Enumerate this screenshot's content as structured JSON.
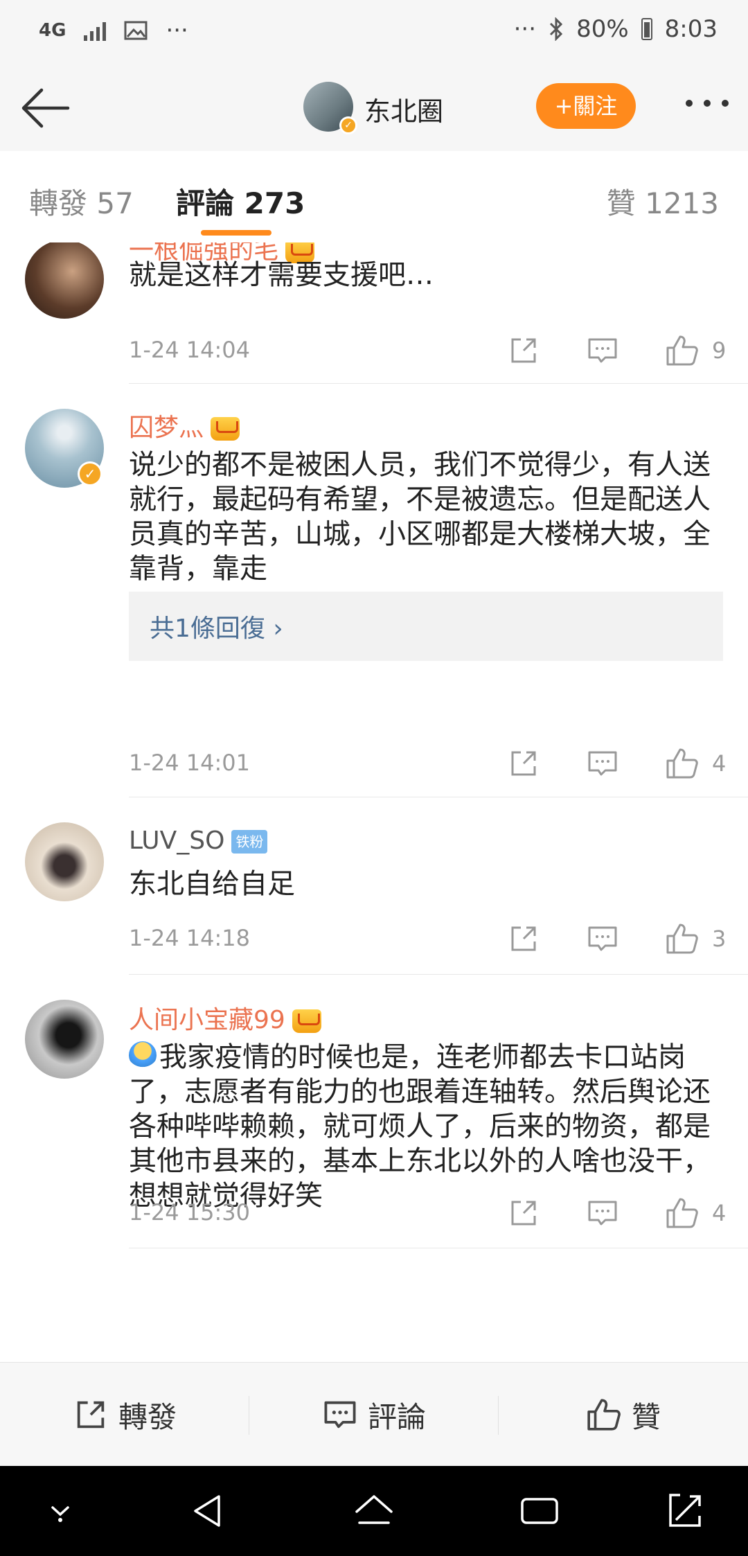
{
  "status_bar": {
    "network": "4G",
    "left_more": "···",
    "right_more": "···",
    "battery": "80%",
    "time": "8:03"
  },
  "header": {
    "group_name": "东北圈",
    "follow_label": "+關注"
  },
  "tabs": {
    "reposts": "轉發 57",
    "comments": "評論 273",
    "likes": "贊 1213"
  },
  "comments": [
    {
      "username": "一根倔强的毛",
      "badge": "crown",
      "content": "就是这样才需要支援吧…",
      "time": "1-24 14:04",
      "likes": "9"
    },
    {
      "username": "囚梦灬",
      "badge": "crown",
      "content": "说少的都不是被困人员，我们不觉得少，有人送就行，最起码有希望，不是被遗忘。但是配送人员真的辛苦，山城，小区哪都是大楼梯大坡，全靠背，靠走",
      "reply_link": "共1條回復 ›",
      "time": "1-24 14:01",
      "likes": "4"
    },
    {
      "username": "LUV_SO",
      "badge_label": "铁粉",
      "content": "东北自给自足",
      "time": "1-24 14:18",
      "likes": "3"
    },
    {
      "username": "人间小宝藏99",
      "badge": "crown",
      "content": "我家疫情的时候也是，连老师都去卡口站岗了，志愿者有能力的也跟着连轴转。然后舆论还各种哔哔赖赖，就可烦人了，后来的物资，都是其他市县来的，基本上东北以外的人啥也没干，想想就觉得好笑",
      "time": "1-24 15:30",
      "likes": "4"
    }
  ],
  "bottom_bar": {
    "repost": "轉發",
    "comment": "評論",
    "like": "贊"
  },
  "colors": {
    "accent": "#ff8a1c",
    "username": "#eb7350",
    "link": "#4a6d94"
  }
}
